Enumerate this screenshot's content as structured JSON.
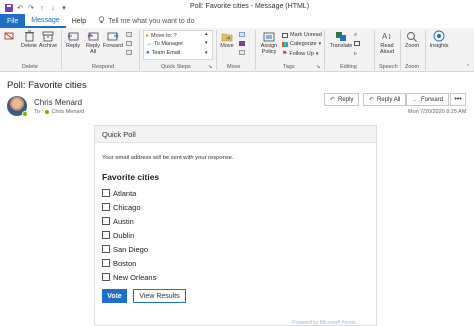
{
  "window": {
    "title": "Poll: Favorite cities  -  Message (HTML)"
  },
  "tabs": [
    {
      "label": "File"
    },
    {
      "label": "Message"
    },
    {
      "label": "Help"
    }
  ],
  "tell_me": {
    "text": "Tell me what you want to do",
    "icon": "lightbulb-icon"
  },
  "ribbon": {
    "groups": {
      "delete": "Delete",
      "respond": "Respond",
      "quick_steps": "Quick Steps",
      "move": "Move",
      "tags": "Tags",
      "editing": "Editing",
      "speech": "Speech",
      "zoom": "Zoom"
    },
    "buttons": {
      "delete": "Delete",
      "archive": "Archive",
      "reply": "Reply",
      "reply_all": "Reply All",
      "forward": "Forward",
      "move": "Move",
      "assign_policy": "Assign Policy",
      "translate": "Translate",
      "read_aloud": "Read Aloud",
      "zoom": "Zoom",
      "insights": "Insights"
    },
    "quick_steps": [
      {
        "label": "Move to: ?"
      },
      {
        "label": "To Manager"
      },
      {
        "label": "Team Email"
      }
    ],
    "tags": {
      "mark_unread": "Mark Unread",
      "categorize": "Categorize",
      "follow_up": "Follow Up"
    }
  },
  "message": {
    "subject": "Poll: Favorite cities",
    "sender": "Chris Menard",
    "to_label": "To",
    "recipient": "Chris Menard",
    "date": "Mon 7/20/2020 8:25 AM",
    "actions": {
      "reply": "Reply",
      "reply_all": "Reply All",
      "forward": "Forward",
      "more": "•••"
    }
  },
  "poll": {
    "header": "Quick Poll",
    "notice": "Your email address will be sent with your response.",
    "title": "Favorite cities",
    "options": [
      {
        "label": "Atlanta",
        "checked": false
      },
      {
        "label": "Chicago",
        "checked": false
      },
      {
        "label": "Austin",
        "checked": false
      },
      {
        "label": "Dublin",
        "checked": false
      },
      {
        "label": "San Diego",
        "checked": false
      },
      {
        "label": "Boston",
        "checked": false
      },
      {
        "label": "New Orleans",
        "checked": false
      }
    ],
    "vote_label": "Vote",
    "results_label": "View Results",
    "powered_by": "Powered by Microsoft Forms"
  },
  "colors": {
    "accent": "#1e6fc5",
    "presence": "#6bb700",
    "save_icon": "#7b3fa0"
  }
}
